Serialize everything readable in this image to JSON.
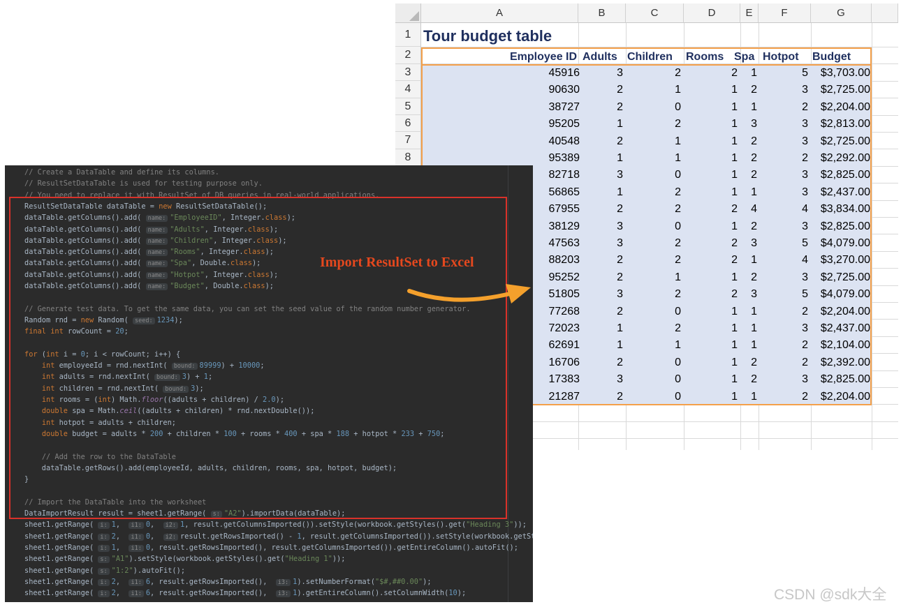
{
  "spreadsheet": {
    "columns": [
      "A",
      "B",
      "C",
      "D",
      "E",
      "F",
      "G"
    ],
    "rows": [
      "1",
      "2",
      "3",
      "4",
      "5",
      "6",
      "7",
      "8"
    ],
    "title": "Tour budget table",
    "headers": [
      "Employee ID",
      "Adults",
      "Children",
      "Rooms",
      "Spa",
      "Hotpot",
      "Budget"
    ],
    "data": [
      [
        "45916",
        "3",
        "2",
        "2",
        "1",
        "5",
        "$3,703.00"
      ],
      [
        "90630",
        "2",
        "1",
        "1",
        "2",
        "3",
        "$2,725.00"
      ],
      [
        "38727",
        "2",
        "0",
        "1",
        "1",
        "2",
        "$2,204.00"
      ],
      [
        "95205",
        "1",
        "2",
        "1",
        "3",
        "3",
        "$2,813.00"
      ],
      [
        "40548",
        "2",
        "1",
        "1",
        "2",
        "3",
        "$2,725.00"
      ],
      [
        "95389",
        "1",
        "1",
        "1",
        "2",
        "2",
        "$2,292.00"
      ],
      [
        "82718",
        "3",
        "0",
        "1",
        "2",
        "3",
        "$2,825.00"
      ],
      [
        "56865",
        "1",
        "2",
        "1",
        "1",
        "3",
        "$2,437.00"
      ],
      [
        "67955",
        "2",
        "2",
        "2",
        "4",
        "4",
        "$3,834.00"
      ],
      [
        "38129",
        "3",
        "0",
        "1",
        "2",
        "3",
        "$2,825.00"
      ],
      [
        "47563",
        "3",
        "2",
        "2",
        "3",
        "5",
        "$4,079.00"
      ],
      [
        "88203",
        "2",
        "2",
        "2",
        "1",
        "4",
        "$3,270.00"
      ],
      [
        "95252",
        "2",
        "1",
        "1",
        "2",
        "3",
        "$2,725.00"
      ],
      [
        "51805",
        "3",
        "2",
        "2",
        "3",
        "5",
        "$4,079.00"
      ],
      [
        "77268",
        "2",
        "0",
        "1",
        "1",
        "2",
        "$2,204.00"
      ],
      [
        "72023",
        "1",
        "2",
        "1",
        "1",
        "3",
        "$2,437.00"
      ],
      [
        "62691",
        "1",
        "1",
        "1",
        "1",
        "2",
        "$2,104.00"
      ],
      [
        "16706",
        "2",
        "0",
        "1",
        "2",
        "2",
        "$2,392.00"
      ],
      [
        "17383",
        "3",
        "0",
        "1",
        "2",
        "3",
        "$2,825.00"
      ],
      [
        "21287",
        "2",
        "0",
        "1",
        "1",
        "2",
        "$2,204.00"
      ]
    ],
    "colors": {
      "accent_border": "#f4a04a",
      "selection": "#dce3f2",
      "title_text": "#1f2f5e"
    }
  },
  "code_lines": [
    "<span class=\"c\">// Create a DataTable and define its columns.</span>",
    "<span class=\"c\">// ResultSetDataTable is used for testing purpose only.</span>",
    "<span class=\"c\">// You need to replace it with ResultSet of DB queries in real-world applications.</span>",
    "ResultSetDataTable dataTable = <span class=\"k\">new</span> ResultSetDataTable();",
    "dataTable.getColumns().add( <span class=\"h\">name:</span><span class=\"s\">\"EmployeeID\"</span>, Integer.<span class=\"k\">class</span>);",
    "dataTable.getColumns().add( <span class=\"h\">name:</span><span class=\"s\">\"Adults\"</span>, Integer.<span class=\"k\">class</span>);",
    "dataTable.getColumns().add( <span class=\"h\">name:</span><span class=\"s\">\"Children\"</span>, Integer.<span class=\"k\">class</span>);",
    "dataTable.getColumns().add( <span class=\"h\">name:</span><span class=\"s\">\"Rooms\"</span>, Integer.<span class=\"k\">class</span>);",
    "dataTable.getColumns().add( <span class=\"h\">name:</span><span class=\"s\">\"Spa\"</span>, Double.<span class=\"k\">class</span>);",
    "dataTable.getColumns().add( <span class=\"h\">name:</span><span class=\"s\">\"Hotpot\"</span>, Integer.<span class=\"k\">class</span>);",
    "dataTable.getColumns().add( <span class=\"h\">name:</span><span class=\"s\">\"Budget\"</span>, Double.<span class=\"k\">class</span>);",
    "",
    "<span class=\"c\">// Generate test data. To get the same data, you can set the seed value of the random number generator.</span>",
    "Random rnd = <span class=\"k\">new</span> Random( <span class=\"h\">seed:</span><span class=\"n\">1234</span>);",
    "<span class=\"k\">final int</span> rowCount = <span class=\"n\">20</span>;",
    "",
    "<span class=\"k\">for</span> (<span class=\"k\">int</span> i = <span class=\"n\">0</span>; i &lt; rowCount; i++) {",
    "    <span class=\"k\">int</span> employeeId = rnd.nextInt( <span class=\"h\">bound:</span><span class=\"n\">89999</span>) + <span class=\"n\">10000</span>;",
    "    <span class=\"k\">int</span> adults = rnd.nextInt( <span class=\"h\">bound:</span><span class=\"n\">3</span>) + <span class=\"n\">1</span>;",
    "    <span class=\"k\">int</span> children = rnd.nextInt( <span class=\"h\">bound:</span><span class=\"n\">3</span>);",
    "    <span class=\"k\">int</span> rooms = (<span class=\"k\">int</span>) Math.<span class=\"f\">floor</span>((adults + children) / <span class=\"n\">2.0</span>);",
    "    <span class=\"k\">double</span> spa = Math.<span class=\"f\">ceil</span>((adults + children) * rnd.nextDouble());",
    "    <span class=\"k\">int</span> hotpot = adults + children;",
    "    <span class=\"k\">double</span> budget = adults * <span class=\"n\">200</span> + children * <span class=\"n\">100</span> + rooms * <span class=\"n\">400</span> + spa * <span class=\"n\">188</span> + hotpot * <span class=\"n\">233</span> + <span class=\"n\">750</span>;",
    "",
    "    <span class=\"c\">// Add the row to the DataTable</span>",
    "    dataTable.getRows().add(employeeId, adults, children, rooms, spa, hotpot, budget);",
    "}",
    "",
    "<span class=\"c\">// Import the DataTable into the worksheet</span>",
    "DataImportResult result = sheet1.getRange( <span class=\"h\">s:</span><span class=\"s\">\"A2\"</span>).importData(dataTable);",
    "sheet1.getRange( <span class=\"h\">i:</span><span class=\"n\">1</span>,  <span class=\"h\">i1:</span><span class=\"n\">0</span>,  <span class=\"h\">i2:</span><span class=\"n\">1</span>, result.getColumnsImported()).setStyle(workbook.getStyles().get(<span class=\"s\">\"Heading 3\"</span>));",
    "sheet1.getRange( <span class=\"h\">i:</span><span class=\"n\">2</span>,  <span class=\"h\">i1:</span><span class=\"n\">0</span>,  <span class=\"h\">i2:</span>result.getRowsImported() - <span class=\"n\">1</span>, result.getColumnsImported()).setStyle(workbook.getStyles",
    "sheet1.getRange( <span class=\"h\">i:</span><span class=\"n\">1</span>,  <span class=\"h\">i1:</span><span class=\"n\">0</span>, result.getRowsImported(), result.getColumnsImported()).getEntireColumn().autoFit();",
    "sheet1.getRange( <span class=\"h\">s:</span><span class=\"s\">\"A1\"</span>).setStyle(workbook.getStyles().get(<span class=\"s\">\"Heading 1\"</span>));",
    "sheet1.getRange( <span class=\"h\">s:</span><span class=\"s\">\"1:2\"</span>).autoFit();",
    "sheet1.getRange( <span class=\"h\">i:</span><span class=\"n\">2</span>,  <span class=\"h\">i1:</span><span class=\"n\">6</span>, result.getRowsImported(),  <span class=\"h\">i3:</span><span class=\"n\">1</span>).setNumberFormat(<span class=\"s\">\"$#,##0.00\"</span>);",
    "sheet1.getRange( <span class=\"h\">i:</span><span class=\"n\">2</span>,  <span class=\"h\">i1:</span><span class=\"n\">6</span>, result.getRowsImported(),  <span class=\"h\">i3:</span><span class=\"n\">1</span>).getEntireColumn().setColumnWidth(<span class=\"n\">10</span>);"
  ],
  "annotation": {
    "text": "Import ResultSet to Excel",
    "color": "#e5481e"
  },
  "watermark": "CSDN @sdk大全"
}
